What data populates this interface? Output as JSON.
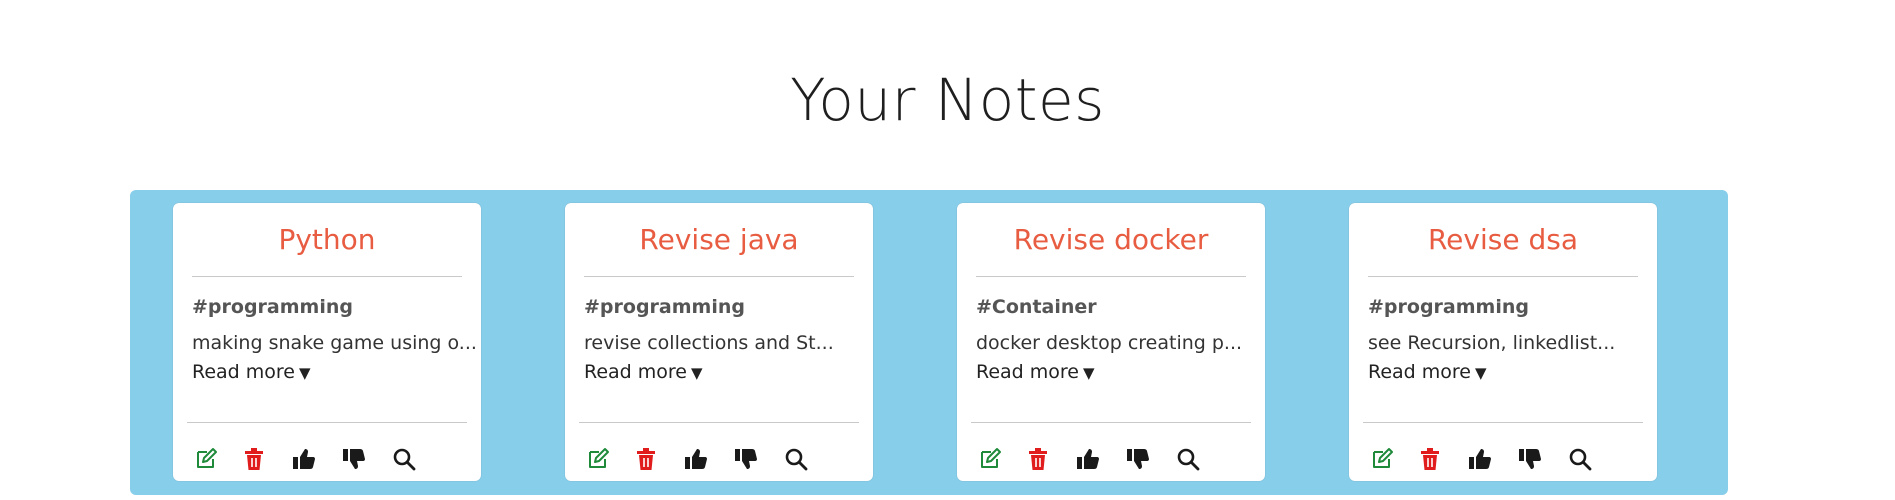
{
  "page": {
    "title": "Your Notes"
  },
  "colors": {
    "panel_background": "#87ceeb",
    "note_title": "#e85c41",
    "edit_icon": "#1e8a3a",
    "delete_icon": "#e01c1c",
    "vote_icon": "#1a1a1a"
  },
  "notes": [
    {
      "title": "Python",
      "tag": "#programming",
      "description": "making snake game using o...",
      "read_more": "Read more",
      "actions": [
        "edit-icon",
        "trash-icon",
        "thumbs-up-icon",
        "thumbs-down-icon",
        "search-icon"
      ]
    },
    {
      "title": "Revise java",
      "tag": "#programming",
      "description": "revise collections and St...",
      "read_more": "Read more",
      "actions": [
        "edit-icon",
        "trash-icon",
        "thumbs-up-icon",
        "thumbs-down-icon",
        "search-icon"
      ]
    },
    {
      "title": "Revise docker",
      "tag": "#Container",
      "description": "docker desktop creating p...",
      "read_more": "Read more",
      "actions": [
        "edit-icon",
        "trash-icon",
        "thumbs-up-icon",
        "thumbs-down-icon",
        "search-icon"
      ]
    },
    {
      "title": "Revise dsa",
      "tag": "#programming",
      "description": "see Recursion, linkedlist...",
      "read_more": "Read more",
      "actions": [
        "edit-icon",
        "trash-icon",
        "thumbs-up-icon",
        "thumbs-down-icon",
        "search-icon"
      ]
    }
  ]
}
